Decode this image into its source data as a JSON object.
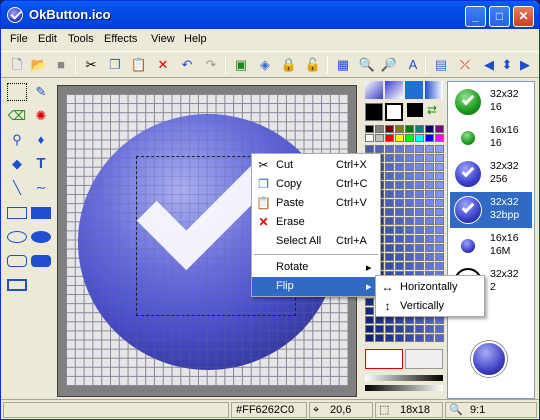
{
  "window": {
    "title": "OkButton.ico",
    "minimize": "_",
    "maximize": "□",
    "close": "✕"
  },
  "menu": [
    "File",
    "Edit",
    "Tools",
    "Effects",
    "View",
    "Help"
  ],
  "context_menu": {
    "items": [
      {
        "label": "Cut",
        "shortcut": "Ctrl+X",
        "icon": "scissors-icon"
      },
      {
        "label": "Copy",
        "shortcut": "Ctrl+C",
        "icon": "copy-icon"
      },
      {
        "label": "Paste",
        "shortcut": "Ctrl+V",
        "icon": "paste-icon"
      },
      {
        "label": "Erase",
        "shortcut": "",
        "icon": "erase-x-icon"
      },
      {
        "label": "Select All",
        "shortcut": "Ctrl+A",
        "icon": ""
      },
      {
        "label": "Rotate",
        "shortcut": "",
        "icon": ""
      },
      {
        "label": "Flip",
        "shortcut": "",
        "icon": ""
      }
    ],
    "highlighted": "Flip"
  },
  "submenu": {
    "items": [
      {
        "label": "Horizontally",
        "icon": "horizontal-arrows-icon"
      },
      {
        "label": "Vertically",
        "icon": "vertical-arrows-icon"
      }
    ]
  },
  "icon_list": [
    {
      "size": "32x32",
      "depth": "16",
      "style": "green",
      "selected": false
    },
    {
      "size": "16x16",
      "depth": "16",
      "style": "green",
      "selected": false
    },
    {
      "size": "32x32",
      "depth": "256",
      "style": "blue",
      "selected": false
    },
    {
      "size": "32x32",
      "depth": "32bpp",
      "style": "blue",
      "selected": true
    },
    {
      "size": "16x16",
      "depth": "16M",
      "style": "blue",
      "selected": false
    },
    {
      "size": "32x32",
      "depth": "2",
      "style": "mono",
      "selected": false
    }
  ],
  "status": {
    "color_hex": "#FF6262C0",
    "coords": "20,6",
    "selection_size": "18x18",
    "zoom": "9:1"
  },
  "colors": {
    "accent": "#316ac5",
    "titlebar": "#0049e3"
  }
}
